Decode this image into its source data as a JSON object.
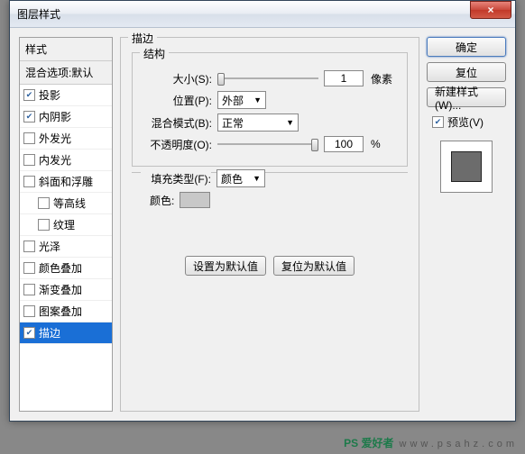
{
  "window": {
    "title": "图层样式",
    "close": "×"
  },
  "sidebar": {
    "header": "样式",
    "blend_header": "混合选项:默认",
    "items": [
      {
        "label": "投影",
        "checked": true,
        "indent": false
      },
      {
        "label": "内阴影",
        "checked": true,
        "indent": false
      },
      {
        "label": "外发光",
        "checked": false,
        "indent": false
      },
      {
        "label": "内发光",
        "checked": false,
        "indent": false
      },
      {
        "label": "斜面和浮雕",
        "checked": false,
        "indent": false
      },
      {
        "label": "等高线",
        "checked": false,
        "indent": true
      },
      {
        "label": "纹理",
        "checked": false,
        "indent": true
      },
      {
        "label": "光泽",
        "checked": false,
        "indent": false
      },
      {
        "label": "颜色叠加",
        "checked": false,
        "indent": false
      },
      {
        "label": "渐变叠加",
        "checked": false,
        "indent": false
      },
      {
        "label": "图案叠加",
        "checked": false,
        "indent": false
      },
      {
        "label": "描边",
        "checked": true,
        "indent": false,
        "selected": true
      }
    ]
  },
  "panel": {
    "title": "描边",
    "struct_title": "结构",
    "size_label": "大小(S):",
    "size_value": "1",
    "size_unit": "像素",
    "position_label": "位置(P):",
    "position_value": "外部",
    "blend_label": "混合模式(B):",
    "blend_value": "正常",
    "opacity_label": "不透明度(O):",
    "opacity_value": "100",
    "opacity_unit": "%",
    "filltype_label": "填充类型(F):",
    "filltype_value": "颜色",
    "color_label": "颜色:",
    "set_default": "设置为默认值",
    "reset_default": "复位为默认值"
  },
  "right": {
    "ok": "确定",
    "cancel": "复位",
    "newstyle": "新建样式(W)...",
    "preview_label": "预览(V)",
    "preview_checked": true
  },
  "watermark": {
    "logo": "PS 爱好者",
    "sub": "www.psahz.com"
  }
}
